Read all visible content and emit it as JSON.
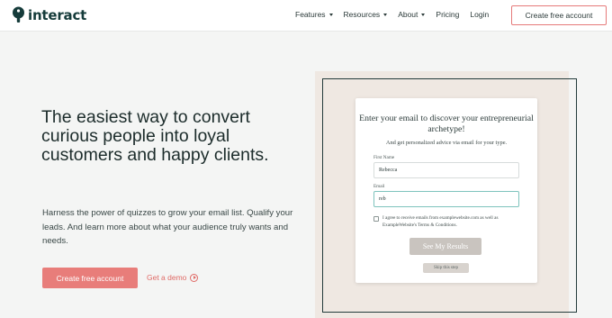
{
  "nav": {
    "logo_text": "interact",
    "links": [
      {
        "label": "Features",
        "has_dropdown": true
      },
      {
        "label": "Resources",
        "has_dropdown": true
      },
      {
        "label": "About",
        "has_dropdown": true
      },
      {
        "label": "Pricing",
        "has_dropdown": false
      },
      {
        "label": "Login",
        "has_dropdown": false
      }
    ],
    "cta_label": "Create free account"
  },
  "hero": {
    "title": "The easiest way to convert curious people into loyal customers and happy clients.",
    "subtitle": "Harness the power of quizzes to grow your email list. Qualify your leads. And learn more about what your audience truly wants and needs.",
    "primary_cta": "Create free account",
    "secondary_cta": "Get a demo"
  },
  "quiz_card": {
    "title": "Enter your email to discover your entrepreneurial archetype!",
    "subtitle": "And get personalized advice via email for your type.",
    "first_name_label": "First Name",
    "first_name_value": "Rebecca",
    "email_label": "Email",
    "email_value": "reb",
    "agree_text": "I agree to receive emails from examplewebsite.com as well as ExampleWebsite's Terms & Conditions.",
    "submit_label": "See My Results",
    "skip_label": "Skip this step"
  },
  "colors": {
    "accent": "#e87d7a",
    "brand_dark": "#153b3a",
    "panel_bg": "#efe8e2",
    "focus_border": "#7fc3bd"
  }
}
